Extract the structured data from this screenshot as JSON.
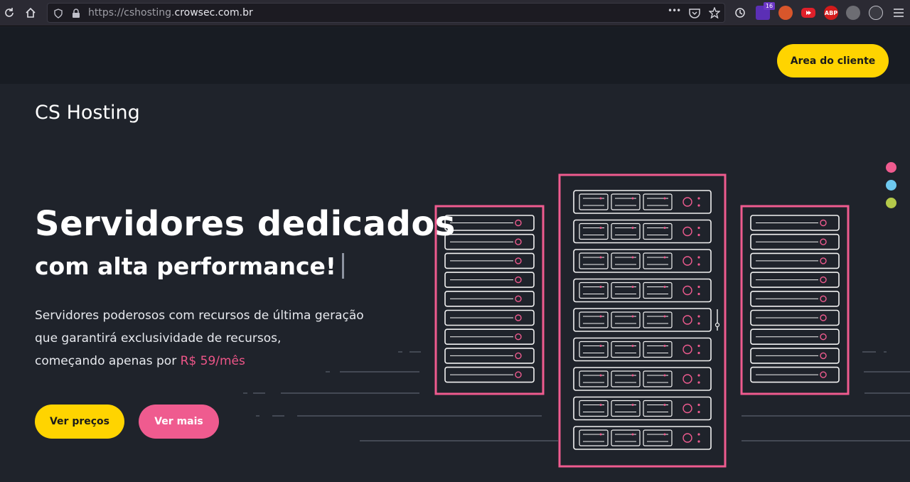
{
  "browser": {
    "url_prefix": "https://cshosting.",
    "url_host": "crowsec.com.br",
    "ellipsis": "•••",
    "extension_badge": "16",
    "abp_label": "ABP"
  },
  "header": {
    "client_button": "Area do cliente"
  },
  "brand": "CS Hosting",
  "hero": {
    "title": "Servidores dedicados",
    "subtitle": "com alta performance!",
    "desc_line1": "Servidores poderosos com recursos de última geração",
    "desc_line2": "que garantirá exclusividade de recursos,",
    "desc_line3_prefix": "começando apenas por",
    "price": "R$ 59/mês",
    "btn_prices": "Ver preços",
    "btn_more": "Ver mais"
  },
  "theme_dots": [
    {
      "name": "pink",
      "color": "#ef5b8f"
    },
    {
      "name": "blue",
      "color": "#6ec9f0"
    },
    {
      "name": "green",
      "color": "#b4c94a"
    }
  ],
  "colors": {
    "accent_yellow": "#ffd400",
    "accent_pink": "#ef5b8f",
    "background": "#1f232b"
  }
}
